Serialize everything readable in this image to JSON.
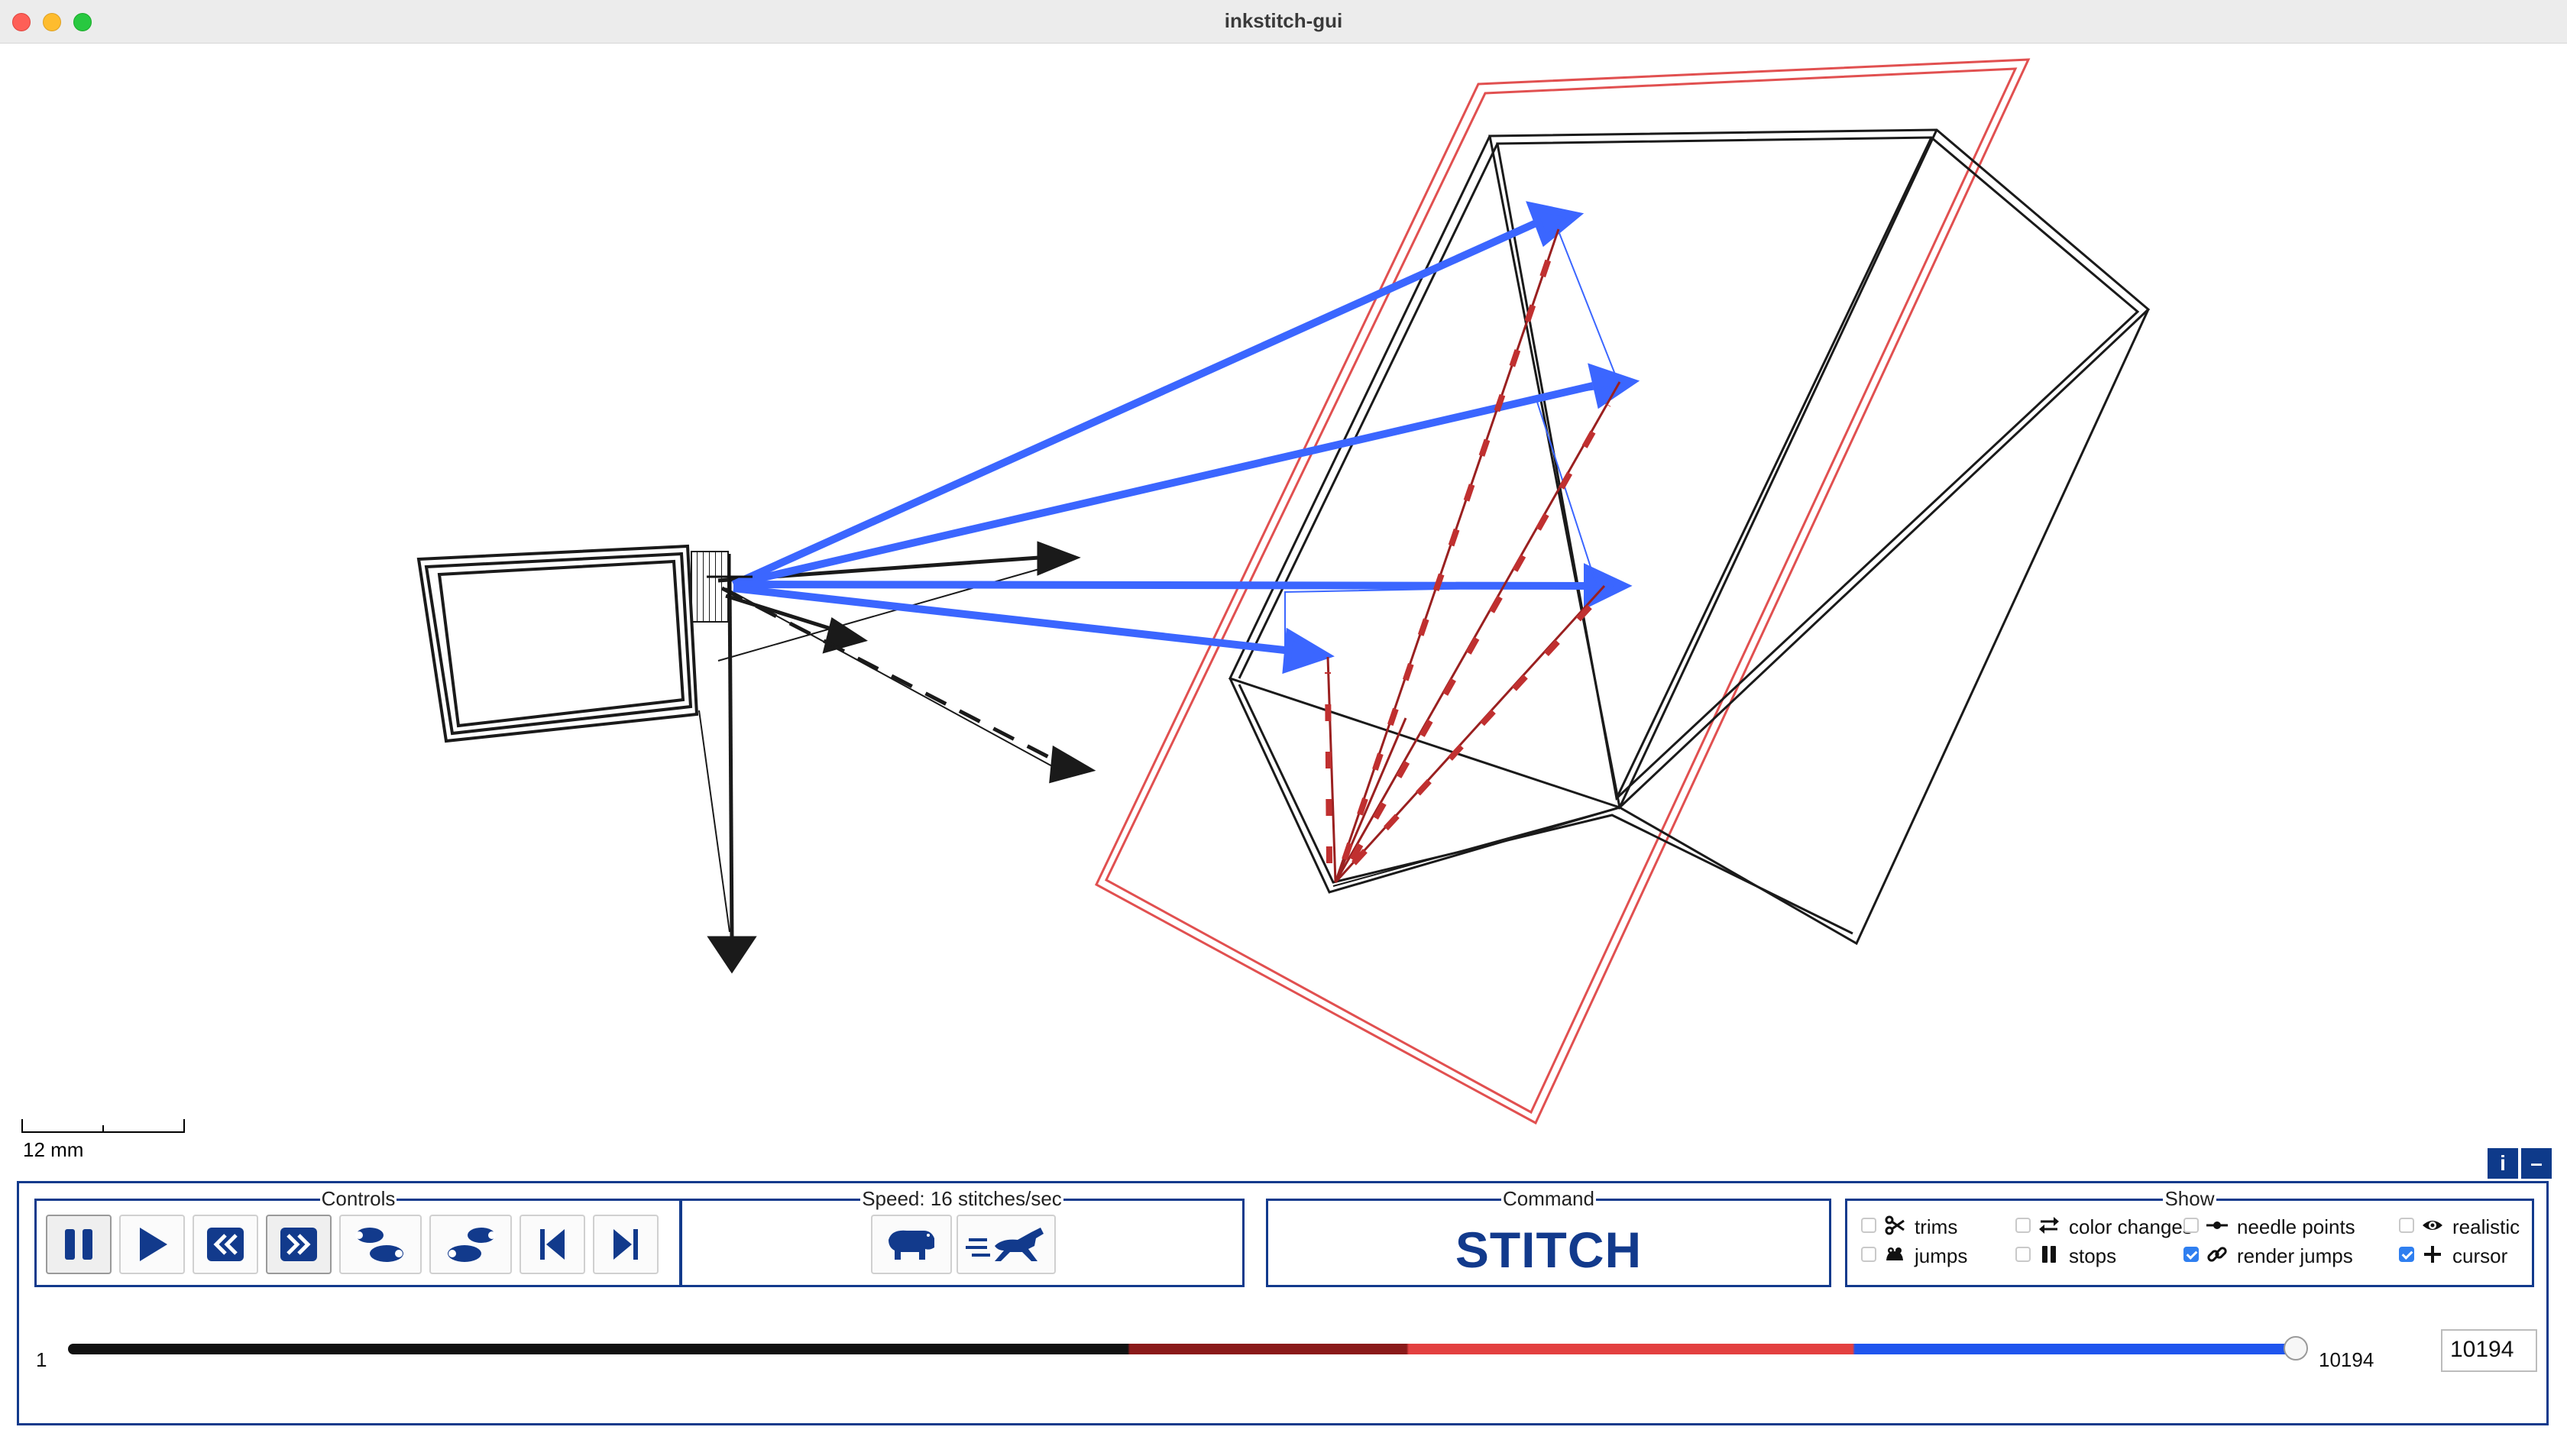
{
  "window": {
    "title": "inkstitch-gui"
  },
  "canvas": {
    "scale_label": "12 mm",
    "colors": {
      "black_stitch": "#1a1a1a",
      "blue_stitch": "#3b66ff",
      "red_stitch": "#e15050",
      "darkred_stitch": "#9a2020"
    }
  },
  "info_button": "i",
  "minimize_button": "–",
  "controls": {
    "label": "Controls",
    "buttons": [
      {
        "name": "pause",
        "icon": "pause-icon"
      },
      {
        "name": "play",
        "icon": "play-icon"
      },
      {
        "name": "reverse",
        "icon": "rewind-icon"
      },
      {
        "name": "forward",
        "icon": "fast-forward-icon"
      },
      {
        "name": "previous-command",
        "icon": "footsteps-back-icon"
      },
      {
        "name": "next-command",
        "icon": "footsteps-forward-icon"
      },
      {
        "name": "first-stitch",
        "icon": "skip-start-icon"
      },
      {
        "name": "last-stitch",
        "icon": "skip-end-icon"
      }
    ]
  },
  "speed": {
    "label": "Speed: 16 stitches/sec",
    "buttons": [
      {
        "name": "slower",
        "icon": "hippo-icon"
      },
      {
        "name": "faster",
        "icon": "horse-icon"
      }
    ]
  },
  "command": {
    "label": "Command",
    "value": "STITCH"
  },
  "show": {
    "label": "Show",
    "options": [
      {
        "label": "trims",
        "checked": false,
        "icon": "scissors-icon"
      },
      {
        "label": "jumps",
        "checked": false,
        "icon": "frog-icon"
      },
      {
        "label": "color changes",
        "checked": false,
        "icon": "swap-arrows-icon"
      },
      {
        "label": "stops",
        "checked": false,
        "icon": "pause-bars-icon"
      },
      {
        "label": "needle points",
        "checked": false,
        "icon": "needle-point-icon"
      },
      {
        "label": "render jumps",
        "checked": true,
        "icon": "link-icon"
      },
      {
        "label": "realistic",
        "checked": false,
        "icon": "eye-icon"
      },
      {
        "label": "cursor",
        "checked": true,
        "icon": "plus-icon"
      }
    ]
  },
  "slider": {
    "min": "1",
    "max": "10194",
    "value": 10194,
    "current_stitch": "10194"
  }
}
